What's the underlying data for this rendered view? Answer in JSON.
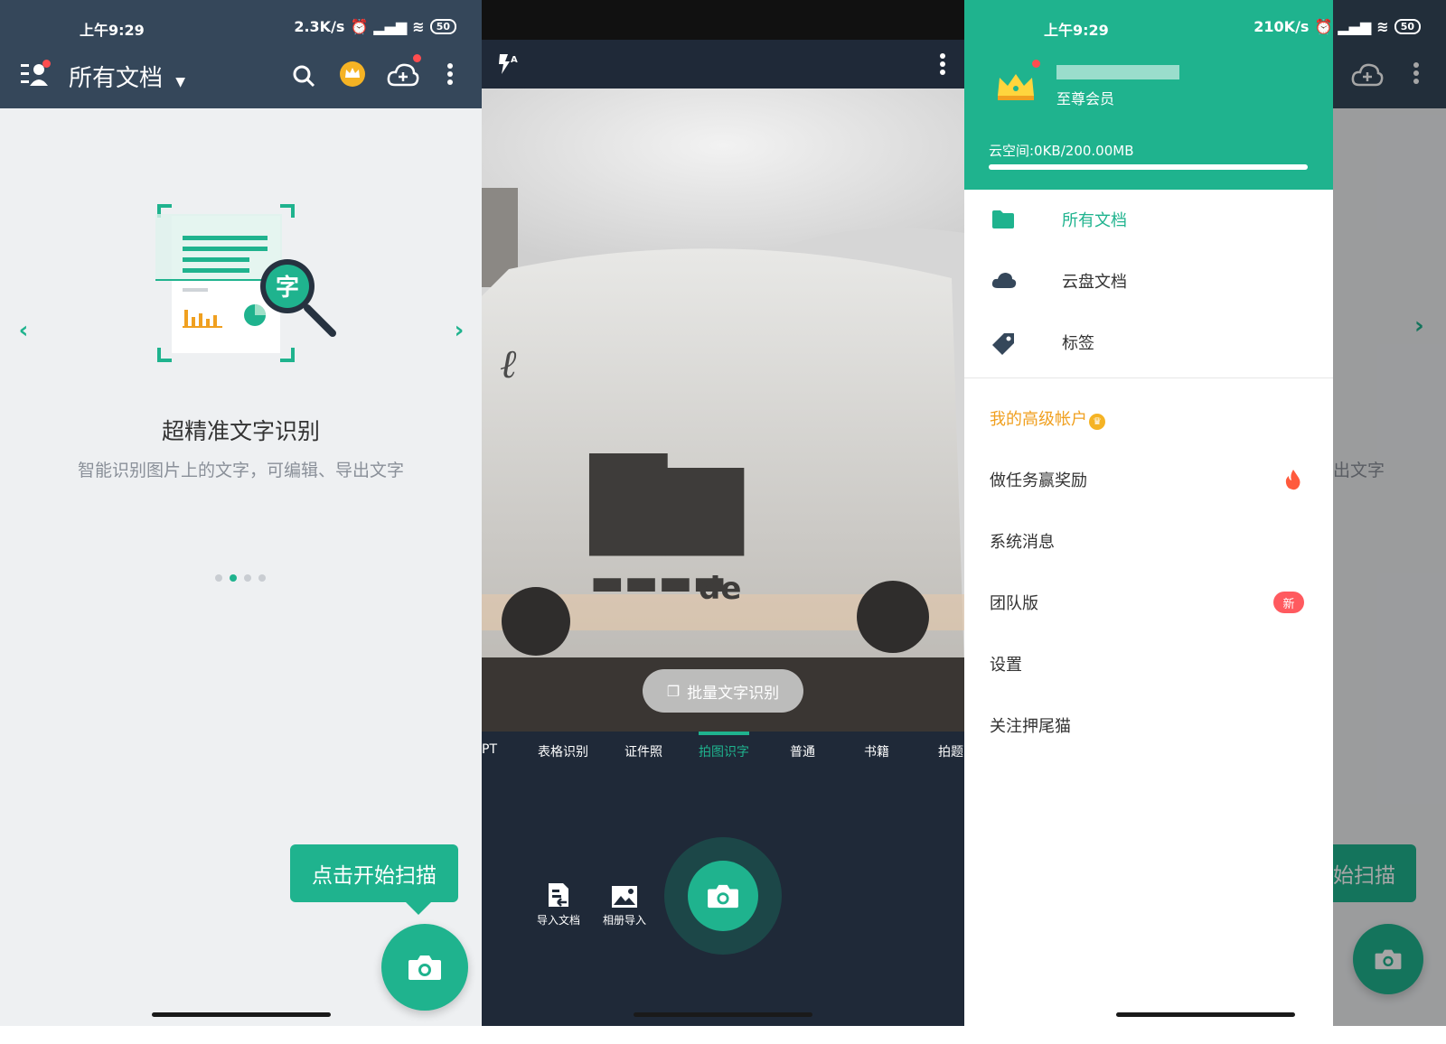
{
  "colors": {
    "accent": "#1fb38e",
    "toolbar": "#35475a",
    "camera_bg": "#1f2938",
    "premium": "#f0a020",
    "badge_red": "#ff5a5f"
  },
  "panel1": {
    "status": {
      "time": "上午9:29",
      "speed": "2.3K/s",
      "battery": "50"
    },
    "toolbar": {
      "title": "所有文档",
      "icons": [
        "profile-icon",
        "search-icon",
        "crown-icon",
        "cloud-upload-icon",
        "more-icon"
      ]
    },
    "carousel": {
      "illustration_badge": "字",
      "title": "超精准文字识别",
      "subtitle": "智能识别图片上的文字，可编辑、导出文字",
      "total_pages": 4,
      "active_page": 2
    },
    "tooltip": "点击开始扫描"
  },
  "panel2": {
    "batch_button": "批量文字识别",
    "modes": [
      "PT",
      "表格识别",
      "证件照",
      "拍图识字",
      "普通",
      "书籍",
      "拍题"
    ],
    "active_mode": "拍图识字",
    "tools": {
      "import_doc": "导入文档",
      "album_import": "相册导入"
    },
    "icons": [
      "flash-auto-icon",
      "more-icon",
      "shutter-camera-icon"
    ]
  },
  "panel3": {
    "status": {
      "time": "上午9:29",
      "speed": "210K/s",
      "battery": "50"
    },
    "header": {
      "member_level": "至尊会员",
      "cloud_space": "云空间:0KB/200.00MB",
      "cloud_used_fraction": 0.0
    },
    "nav": [
      {
        "label": "所有文档",
        "icon": "folder-icon",
        "active": true
      },
      {
        "label": "云盘文档",
        "icon": "cloud-icon",
        "active": false
      },
      {
        "label": "标签",
        "icon": "tag-icon",
        "active": false
      }
    ],
    "premium_account": "我的高级帐户",
    "menu": [
      {
        "label": "做任务赢奖励",
        "badge": "fire"
      },
      {
        "label": "系统消息",
        "badge": ""
      },
      {
        "label": "团队版",
        "badge": "新"
      },
      {
        "label": "设置",
        "badge": ""
      },
      {
        "label": "关注押尾猫",
        "badge": ""
      }
    ],
    "ghost": {
      "subtitle_tail": "出文字",
      "tooltip_tail": "始扫描"
    }
  }
}
